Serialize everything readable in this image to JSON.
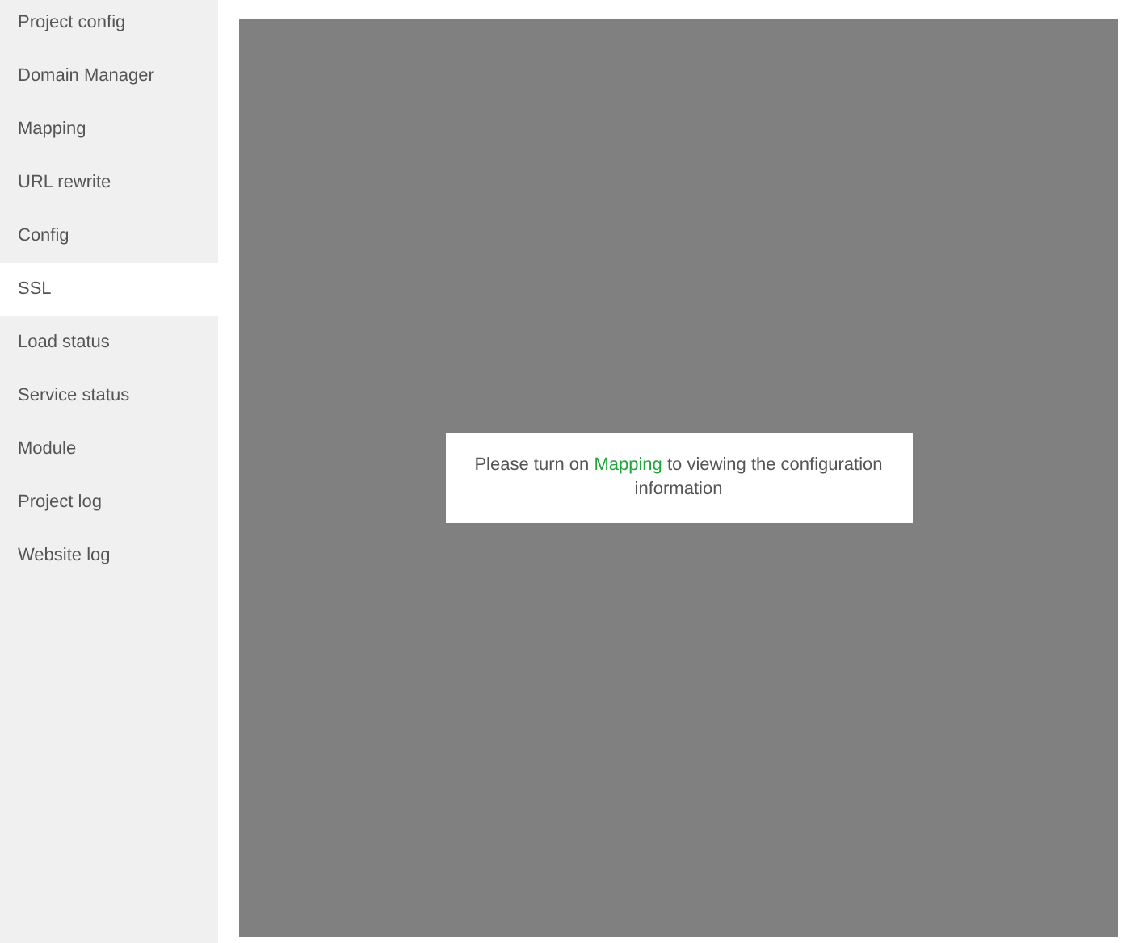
{
  "sidebar": {
    "items": [
      {
        "label": "Project config",
        "selected": false
      },
      {
        "label": "Domain Manager",
        "selected": false
      },
      {
        "label": "Mapping",
        "selected": false
      },
      {
        "label": "URL rewrite",
        "selected": false
      },
      {
        "label": "Config",
        "selected": false
      },
      {
        "label": "SSL",
        "selected": true
      },
      {
        "label": "Load status",
        "selected": false
      },
      {
        "label": "Service status",
        "selected": false
      },
      {
        "label": "Module",
        "selected": false
      },
      {
        "label": "Project log",
        "selected": false
      },
      {
        "label": "Website log",
        "selected": false
      }
    ]
  },
  "notice": {
    "before": "Please turn on",
    "link": "Mapping",
    "after": "to viewing the configuration information"
  }
}
